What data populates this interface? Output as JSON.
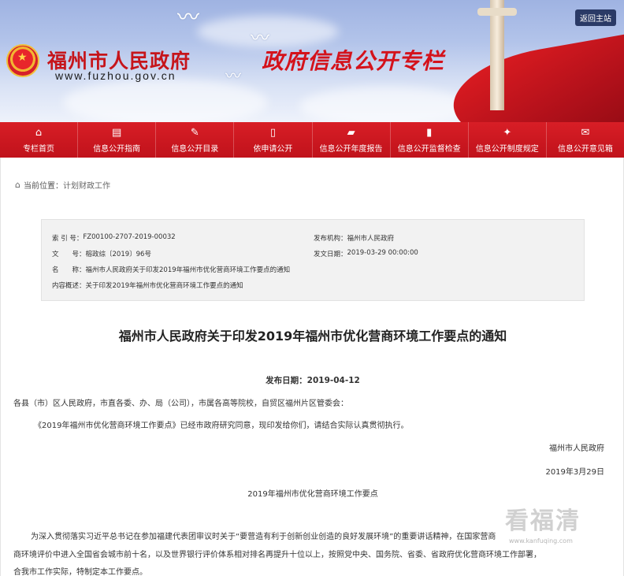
{
  "banner": {
    "site_name": "福州市人民政府",
    "site_url": "www.fuzhou.gov.cn",
    "column_title": "政府信息公开专栏",
    "back_home": "返回主站"
  },
  "nav": {
    "items": [
      {
        "label": "专栏首页",
        "icon": "home-icon"
      },
      {
        "label": "信息公开指南",
        "icon": "guide-icon"
      },
      {
        "label": "信息公开目录",
        "icon": "catalog-icon"
      },
      {
        "label": "依申请公开",
        "icon": "document-icon"
      },
      {
        "label": "信息公开年度报告",
        "icon": "folder-icon"
      },
      {
        "label": "信息公开监督检查",
        "icon": "clipboard-icon"
      },
      {
        "label": "信息公开制度规定",
        "icon": "rules-icon"
      },
      {
        "label": "信息公开意见箱",
        "icon": "mailbox-icon"
      }
    ],
    "colors": {
      "bar": "#c8161f",
      "text": "#ffffff"
    }
  },
  "breadcrumb": {
    "prefix": "当前位置：",
    "current": "计划财政工作"
  },
  "meta": {
    "index_label": "索 引 号：",
    "index_value": "FZ00100-2707-2019-00032",
    "org_label": "发布机构：",
    "org_value": "福州市人民政府",
    "doc_no_label": "文　　号：",
    "doc_no_value": "榕政综〔2019〕96号",
    "date_label": "发文日期：",
    "date_value": "2019-03-29 00:00:00",
    "name_label": "名　　称：",
    "name_value": "福州市人民政府关于印发2019年福州市优化营商环境工作要点的通知",
    "summary_label": "内容概述：",
    "summary_value": "关于印发2019年福州市优化营商环境工作要点的通知"
  },
  "article": {
    "title": "福州市人民政府关于印发2019年福州市优化营商环境工作要点的通知",
    "publish_date": "发布日期：2019-04-12",
    "salutation": "各县（市）区人民政府，市直各委、办、局（公司），市属各高等院校，自贸区福州片区管委会：",
    "body1": "《2019年福州市优化营商环境工作要点》已经市政府研究同意，现印发给你们，请结合实际认真贯彻执行。",
    "signature": "福州市人民政府",
    "sign_date": "2019年3月29日",
    "attachment_title": "2019年福州市优化营商环境工作要点",
    "body2_line1": "为深入贯彻落实习近平总书记在参加福建代表团审议时关于“要营造有利于创新创业创造的良好发展环境”的重要讲话精神，在国家营商",
    "body2_line2": "商环境评价中进入全国省会城市前十名，以及世界银行评价体系相对排名再提升十位以上，按照党中央、国务院、省委、省政府优化营商环境工作部署，",
    "body2_line3": "合我市工作实际，特制定本工作要点。"
  },
  "watermark": {
    "text": "看福清",
    "url": "www.kanfuqing.com"
  }
}
